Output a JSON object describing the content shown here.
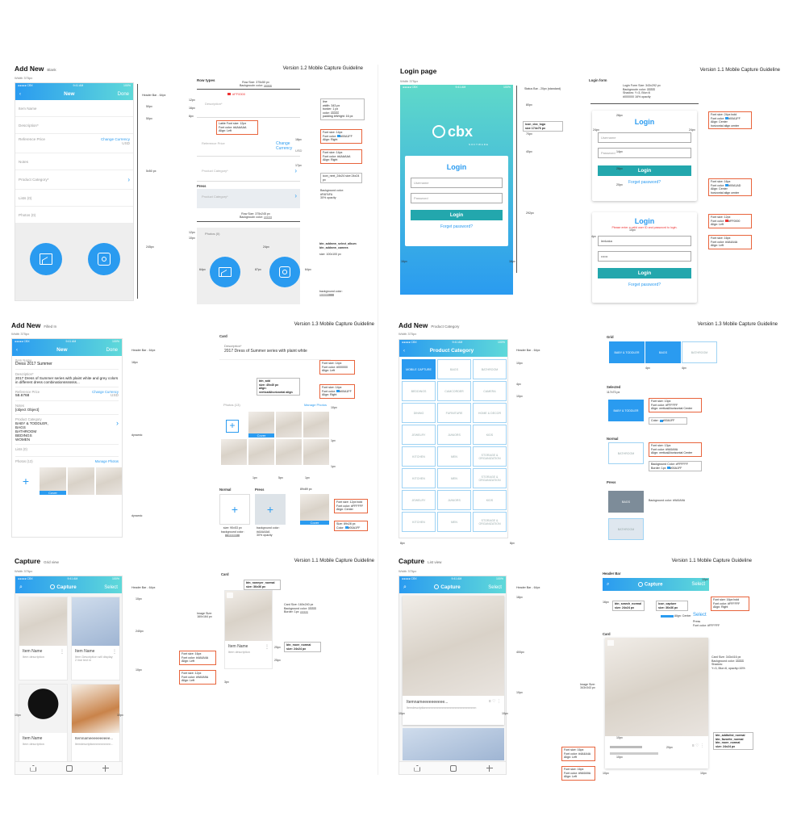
{
  "add_new_blank": {
    "title": "Add New",
    "subtitle": "Blank",
    "version": "Version 1.2   Mobile Capture Guideline",
    "width_label": "Width 375px",
    "status_time": "9:41 AM",
    "status_carrier": "●●●●● CBX",
    "status_battery": "100%",
    "nav_title": "New",
    "done": "Done",
    "rows": {
      "item_name": "Item Name",
      "description": "Description*",
      "ref_price": "Reference Price",
      "change_currency": "Change Currency",
      "usd": "USD",
      "notes": "Notes",
      "product_category": "Product Category*",
      "lists": "Lists (0)",
      "photos": "Photos (0)"
    },
    "header_bar_label": "Header Bar - 64px",
    "dim_50a": "50px",
    "dim_50b": "50px",
    "dim_5x50": "5x50 px",
    "dim_245": "245px",
    "row_types": {
      "title": "Row types",
      "row_size": "Row Size: 375x50 px",
      "bg": "Backgroudn color:",
      "bg_sw": "#FFFFFF",
      "red_label": "#FF0000",
      "desc": "Description*",
      "ref": "Reference Price",
      "change": "Change Currency",
      "usd": "USD",
      "product": "Product Category*",
      "press": "Press",
      "product_press": "Product Category*",
      "photos": "Photos (0)"
    },
    "notes": {
      "line": "line\nwidth: 343 px\nborder: 1 px\ncolor:",
      "line_sw": "#AAAAAA",
      "line_pad": "padding left/right: 16 px",
      "label": "Lable Font size: 12px\nFont color:",
      "label_sw": "#AAAAAA",
      "label_align": "Align: Left",
      "fs14a": "Font size: 14px\nFont color:",
      "fs14a_sw": "#00A1FF",
      "fs14a_align": "Align: Right",
      "fs14b": "Font size: 14px\nFont color:",
      "fs14b_sw": "#AAAAAA",
      "fs14b_align": "Align: Right",
      "icon_next": "icon_next_24x24\nsize 24x24 px",
      "press_bg": "Background color:",
      "press_bg_sw": "#FAFAFA",
      "press_op": "30% opacity",
      "btn_album": "btn_addnew_select_album\nbtn_addnew_camera",
      "btn_size": "size: 100x100 px",
      "bg_color": "background color:",
      "bg_sw2": "#EAEAEA",
      "row_size2": "Row Size: 375x245 px",
      "bg2": "Backgroudn color:",
      "bg2_sw": "#EEEEEE"
    },
    "dims": {
      "d12": "12px",
      "d16": "16px",
      "d8": "8px",
      "d18": "18px",
      "d17": "17px",
      "d64a": "64px",
      "d87": "87px",
      "d64b": "64px",
      "d24": "24px",
      "d10": "10px",
      "d12b": "12px",
      "d16b": "16px",
      "d12c": "12px"
    }
  },
  "login": {
    "title": "Login page",
    "version": "Version 1.1   Mobile Capture Guideline",
    "width_label": "Width 375px",
    "status": "Status Bar - 20px (standard)",
    "logo_brand": "cbx",
    "logo_sub": "SOFTWARE",
    "box_title": "Login",
    "username": "Username",
    "password": "Password",
    "btn": "Login",
    "forgot": "Forget password?",
    "icon_logo": "icon_cbx_logo\nsize 174x76 px",
    "d80": "80px",
    "d70": "70px",
    "d40": "40px",
    "d292": "292px",
    "d16a": "16px",
    "d16b": "16px",
    "form_title": "Login form",
    "form_size": "Login Form Size: 343x292 px\nBackgroudn color:",
    "form_bg": "#FFFFFF",
    "form_shadow": "Shadow: Y=3, Blur=6\n#000000  16% opacity",
    "f_d28": "28px",
    "f_d24a": "24px",
    "f_d24b": "24px",
    "f_d14": "14px",
    "f_d28b": "28px",
    "f_d20": "20px",
    "f_login": "Login",
    "f_user": "Username",
    "f_pass": "Password",
    "f_btn": "Login",
    "f_forgot": "Forget password?",
    "n_title": "Font size: 24px bold\nFont color:",
    "n_title_sw": "#00A1FF",
    "n_title_align": "Align: Center\nhorizontal align center",
    "n_link": "Font size: 16px\nFont color:",
    "n_link_sw": "#00A1AD",
    "n_link_align": "Align: Center\nhorizontal align center",
    "err_login": "Login",
    "err_msg": "Please enter a valid user ID and password to login.",
    "err_user": "lenkaka",
    "err_pass": "••••••",
    "err_btn": "Login",
    "err_forgot": "Forget password?",
    "n_err": "Font size: 12px\nFont color:",
    "n_err_sw": "#FF0000",
    "n_err_align": "Align: Left",
    "n_in": "Font size: 16px\nFont color:",
    "n_in_sw": "#4A4A4A",
    "n_in_align": "Align: Left",
    "d10": "10px",
    "d4": "4px"
  },
  "add_new_filled": {
    "title": "Add New",
    "subtitle": "Filled In",
    "version": "Version 1.3   Mobile Capture Guideline",
    "width_label": "Width 375px",
    "nav_title": "New",
    "done": "Done",
    "status_time": "9:41 AM",
    "item_name_label": "Item Name",
    "item_name": "Dress 2017 Summer",
    "desc_label": "Description*",
    "desc": "2017 Dress of Summer series with plaint white and grey colors in different dress combinationsssssss...",
    "ref_label": "Reference Price",
    "change_currency": "Change Currency",
    "price": "58.6768",
    "usd": "USD",
    "notes_label": "Notes",
    "notes": {
      "fs14": "Font size: 14px\nFont color:",
      "fs14_sw": "#000000",
      "fs14_align": "Align: Left",
      "btn_add": "btn_add\nsize: 40x40 px\nalign:\nvertical&horizontal align",
      "fs14b": "Font size: 14px\nFont color:",
      "fs14b_sw": "#00A1FF",
      "fs14b_align": "Align: Right",
      "fs12": "Font size: 12px bold\nFont color:",
      "fs12_sw": "#FFFFFF",
      "fs12_align": "Align: Center",
      "sz": "Size: 89x28 px\nColor:",
      "sz_sw": "#00A1FF"
    },
    "cat_label": "Product Category",
    "cat": "BABY & TODDLER,\nBAGS\nBATHROOM\nBEDINGS\nWOMEN",
    "lists": "Lists (0)",
    "photos": "Photos (13)",
    "manage": "Manage Photos",
    "cover": "Cover",
    "header": "Header Bar - 64px",
    "d18": "18px",
    "dynamic1": "dynamic",
    "dynamic2": "dynamic",
    "card": {
      "title": "Card",
      "desc_label": "Description*",
      "desc": "2017 Dress of Summer series with plaint white",
      "photos": "Photos (13)",
      "manage": "Manage Photos",
      "cover": "Cover",
      "normal": "Normal",
      "press": "Press",
      "size1": "size: 90x53 px\nbackground color:",
      "size1_sw": "#FFFFFF",
      "size2": "background color:",
      "size2_sw": "#AAAAAA",
      "op": "30% opacity",
      "d89": "89x89 px",
      "d10": "10px",
      "d1a": "1px",
      "d1b": "1px",
      "d1c": "1px",
      "d5": "5px",
      "d1d": "1px"
    }
  },
  "product_category": {
    "title": "Add New",
    "subtitle": "Product Category",
    "version": "Version 1.3   Mobile Capture Guideline",
    "width_label": "Width 375px",
    "nav_title": "Product Category",
    "header": "Header Bar - 64px",
    "status_time": "9:41 AM",
    "cells": [
      "MOBILE CAPTURE",
      "BAGS",
      "BATHROOM",
      "BEDDINGS",
      "CAMCORDER",
      "CAMERA",
      "DINING",
      "FURNITURE",
      "HOME & DECOR",
      "JEWELRY",
      "JUNIORS",
      "KIDS",
      "KITCHEN",
      "MEN",
      "STORAGE & ORGANIZATION",
      "KITCHEN",
      "MEN",
      "STORAGE & ORGANIZATION",
      "JEWELRY",
      "JUNIORS",
      "KIDS",
      "KITCHEN",
      "MEN",
      "STORAGE & ORGANIZATION"
    ],
    "d10a": "10px",
    "d4": "4px",
    "d10b": "10px",
    "d8a": "8px",
    "d8b": "8px",
    "grid": {
      "title": "Grid",
      "c1": "BABY & TODDLER",
      "c2": "BAGS",
      "c3": "BATHROOM",
      "d4": "4px",
      "d4b": "4px"
    },
    "selected": {
      "title": "Selected",
      "size": "117x73 px",
      "cell": "BABY & TODDLER",
      "fs": "Font size: 13px\nFont color:",
      "fs_sw": "#FFFFFF",
      "align": "Align: vertical&horizontal Center",
      "color": "Color:",
      "color_sw": "#00A1FF"
    },
    "normal": {
      "title": "Normal",
      "cell": "BATHROOM",
      "fs": "Font size: 13px\nFont color:",
      "fs_sw": "#9A9A9A",
      "align": "Align: vertical&horizontal Center",
      "bg": "Background Color:",
      "bg_sw": "#FFFFFF",
      "border": "Border: 1px",
      "border_sw": "#00A1FF"
    },
    "press": {
      "title": "Press",
      "cell1": "BAGS",
      "bg": "Background color:",
      "bg_sw": "#9A9A9A",
      "cell2": "BATHROOM"
    }
  },
  "capture_grid": {
    "title": "Capture",
    "subtitle": "Grid view",
    "version": "Version 1.1   Mobile Capture Guideline",
    "width_label": "Width 375px",
    "nav_title": "Capture",
    "select": "Select",
    "status_time": "9:41 AM",
    "header": "Header Bar - 64px",
    "item1_name": "Item Name",
    "item1_desc": "Item description",
    "item2_name": "Item Name",
    "item2_desc": "Item Description will display 2 line text in",
    "item3_name": "Item Name",
    "item3_desc": "Item description",
    "item4_name": "Itemnameeeeeeeeee...",
    "item4_desc": "Itemdescriptionnnnnnnnnnn...",
    "d10": "10px",
    "d240": "240px",
    "d10b": "10px",
    "d10c": "10px",
    "d10d": "10px",
    "card": {
      "title": "Card",
      "btn": "btn_noneyer_normal\nsize: 36x36 px",
      "img": "Image Size:\n160x164 px",
      "name": "Item Name",
      "desc": "Item description",
      "fs16": "Font size: 16px\nFont color:",
      "fs16_sw": "#4A4A4A",
      "fs16_align": "Align: Left",
      "fs12": "Font size: 12px\nFont color:",
      "fs12_sw": "#9A9A9A",
      "fs12_align": "Align: Left",
      "size": "Card Size: 160x240 px\nBackground color:",
      "size_sw": "#FFFFFF",
      "border": "Border: 1px",
      "border_sw": "#E9E9E9",
      "more": "btn_more_normal\nsize: 24x24 px",
      "d25a": "25px",
      "d25b": "25px",
      "d3": "3px"
    }
  },
  "capture_list": {
    "title": "Capture",
    "subtitle": "List view",
    "version": "Version 1.1   Mobile Capture Guideline",
    "width_label": "Width 375px",
    "nav_title": "Capture",
    "select": "Select",
    "status_time": "9:41 AM",
    "header": "Header Bar - 64px",
    "item": "Itemnameeeeeeeeee...",
    "desc": "Itemdescriptionnnnnnnnnnnnnnnnnnnnnnnnnnnnnnnn",
    "d18": "18px",
    "d400": "400px",
    "d10a": "10px",
    "d10b": "10px",
    "d10c": "10px",
    "hb": {
      "title": "Header Bar",
      "capture": "Capture",
      "select": "Select",
      "d10a": "10px",
      "d16": "16px",
      "search": "btn_search_normal\nsize: 24x24 px",
      "icon": "icon_capture\nsize: 36x36 px",
      "fs": "Font size: 16px bold\nFont color:",
      "fs_sw": "#FFFFFF",
      "fs_align": "Align: Right",
      "press": "Press\nFont color:",
      "press_sw": "#FFFFFF",
      "press_label": "Select",
      "align_c": "Align: Center"
    },
    "card": {
      "title": "Card",
      "img": "Image Size:\n343x343 px",
      "size": "Card Size: 343x416 px\nBackground color:",
      "size_sw": "#FFFFFF",
      "shadow": "Shadow:\nY=3, Blur=6, opacity=16%",
      "btns": "btn_addtolist_normal\nbtn_favorite_normal\nbtn_more_normal\nsize: 24x24 px",
      "fs16": "Font size: 16px\nFont color:",
      "fs16_sw": "#4A4A4A",
      "fs16_align": "Align: Left",
      "fs16b": "Font size: 16px\nFont color:",
      "fs16b_sw": "#9A9A9A",
      "fs16b_align": "Align: Left",
      "d10": "10px",
      "d20": "20px",
      "d10b": "10px",
      "d10c": "10px",
      "d10d": "10px"
    }
  },
  "colors": {
    "accent": "#2a9bf0",
    "teal": "#23a7ad",
    "note_border": "#e8643c",
    "error": "#e33333"
  }
}
